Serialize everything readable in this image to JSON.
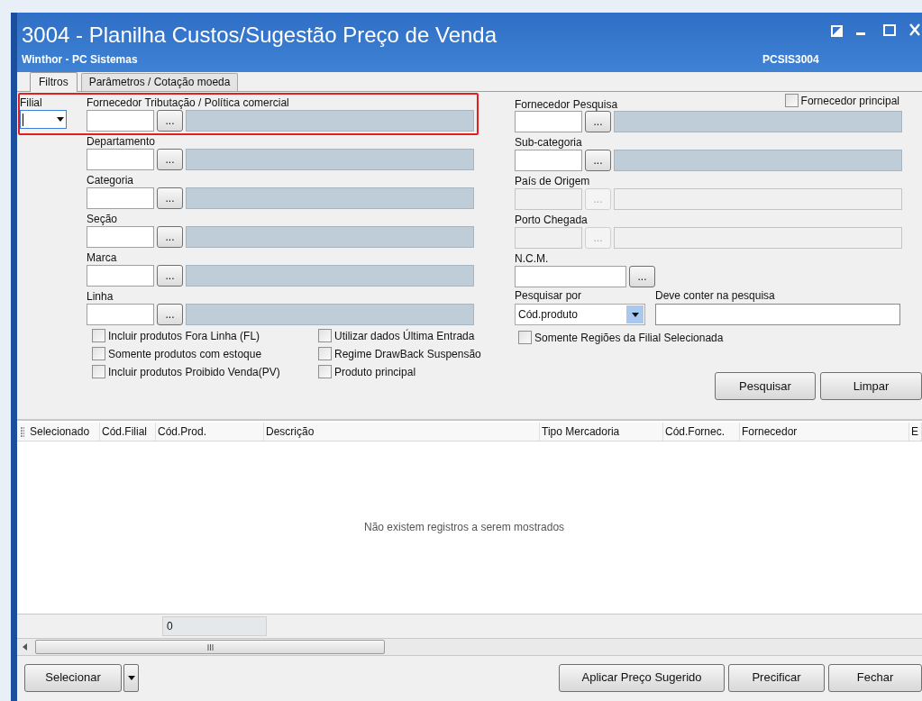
{
  "window": {
    "title": "3004 - Planilha Custos/Sugestão Preço de Venda",
    "subtitle": "Winthor - PC Sistemas",
    "code": "PCSIS3004"
  },
  "tabs": [
    {
      "label": "Filtros",
      "selected": true
    },
    {
      "label": "Parâmetros / Cotação moeda",
      "selected": false
    }
  ],
  "filial": {
    "label": "Filial"
  },
  "lookups_left": [
    {
      "label": "Fornecedor Tributação / Política comercial",
      "kind": "lookup",
      "disabled": false,
      "button": "..."
    },
    {
      "label": "Departamento",
      "kind": "lookup",
      "disabled": false,
      "button": "..."
    },
    {
      "label": "Categoria",
      "kind": "lookup",
      "disabled": false,
      "button": "..."
    },
    {
      "label": "Seção",
      "kind": "lookup",
      "disabled": false,
      "button": "..."
    },
    {
      "label": "Marca",
      "kind": "lookup",
      "disabled": false,
      "button": "..."
    },
    {
      "label": "Linha",
      "kind": "lookup",
      "disabled": false,
      "button": "..."
    }
  ],
  "fornecedor_principal": {
    "label": "Fornecedor principal",
    "checked": false
  },
  "lookups_right": [
    {
      "label": "Fornecedor Pesquisa",
      "kind": "lookup",
      "disabled": false,
      "button": "..."
    },
    {
      "label": "Sub-categoria",
      "kind": "lookup",
      "disabled": false,
      "button": "..."
    },
    {
      "label": "País de Origem",
      "kind": "lookup",
      "disabled": true,
      "button": "..."
    },
    {
      "label": "Porto Chegada",
      "kind": "lookup",
      "disabled": true,
      "button": "..."
    },
    {
      "label": "N.C.M.",
      "kind": "code",
      "disabled": false,
      "button": "..."
    }
  ],
  "pesquisar_por": {
    "label": "Pesquisar por",
    "value": "Cód.produto"
  },
  "deve_conter": {
    "label": "Deve conter na pesquisa"
  },
  "options_col1": [
    {
      "label": "Incluir produtos Fora Linha (FL)",
      "checked": false
    },
    {
      "label": "Somente produtos com estoque",
      "checked": false
    },
    {
      "label": "Incluir produtos Proibido Venda(PV)",
      "checked": false
    }
  ],
  "options_col2": [
    {
      "label": "Utilizar dados Última Entrada",
      "checked": false
    },
    {
      "label": "Regime DrawBack Suspensão",
      "checked": false
    },
    {
      "label": "Produto principal",
      "checked": false
    }
  ],
  "options_right": [
    {
      "label": "Somente Regiões da Filial Selecionada",
      "checked": false
    }
  ],
  "search_buttons": [
    "Pesquisar",
    "Limpar"
  ],
  "table": {
    "columns": [
      "Selecionado",
      "Cód.Filial",
      "Cód.Prod.",
      "Descrição",
      "Tipo Mercadoria",
      "Cód.Fornec.",
      "Fornecedor",
      "E"
    ],
    "empty_message": "Não existem registros a serem mostrados",
    "total": "0"
  },
  "bottom_buttons": [
    {
      "label": "Selecionar",
      "kind": "split"
    },
    {
      "label": "Aplicar Preço Sugerido",
      "kind": "plain"
    },
    {
      "label": "Precificar",
      "kind": "plain"
    },
    {
      "label": "Fechar",
      "kind": "plain"
    }
  ]
}
